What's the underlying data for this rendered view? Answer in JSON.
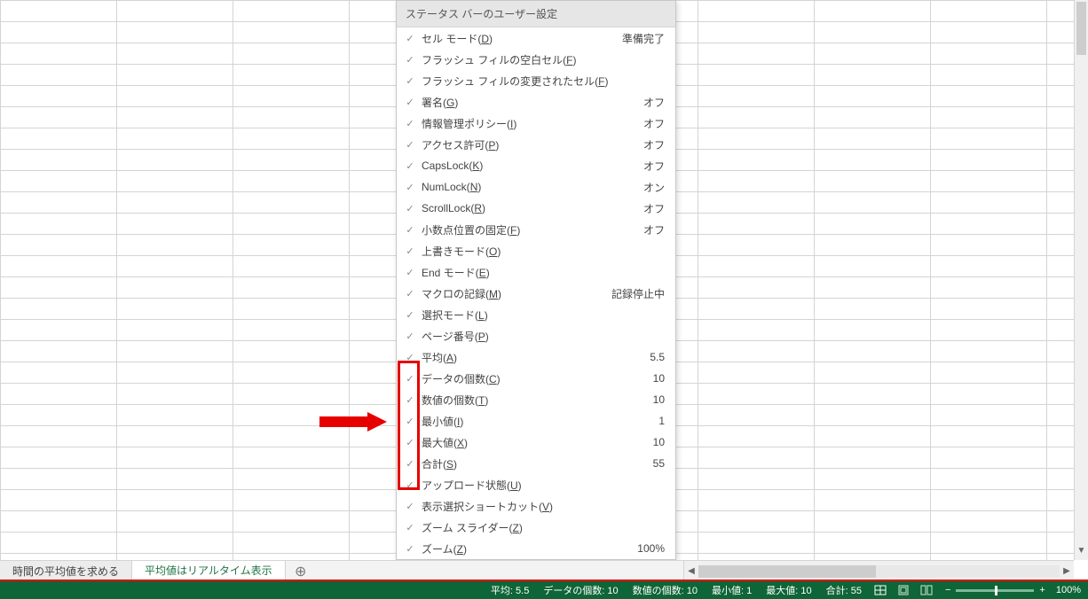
{
  "menu": {
    "title": "ステータス バーのユーザー設定",
    "items": [
      {
        "label": "セル モード(D)",
        "ul": "D",
        "status": "準備完了"
      },
      {
        "label": "フラッシュ フィルの空白セル(F)",
        "ul": "F",
        "status": ""
      },
      {
        "label": "フラッシュ フィルの変更されたセル(F)",
        "ul": "F",
        "status": ""
      },
      {
        "label": "署名(G)",
        "ul": "G",
        "status": "オフ"
      },
      {
        "label": "情報管理ポリシー(I)",
        "ul": "I",
        "status": "オフ"
      },
      {
        "label": "アクセス許可(P)",
        "ul": "P",
        "status": "オフ"
      },
      {
        "label": "CapsLock(K)",
        "ul": "K",
        "status": "オフ"
      },
      {
        "label": "NumLock(N)",
        "ul": "N",
        "status": "オン"
      },
      {
        "label": "ScrollLock(R)",
        "ul": "R",
        "status": "オフ"
      },
      {
        "label": "小数点位置の固定(F)",
        "ul": "F",
        "status": "オフ"
      },
      {
        "label": "上書きモード(O)",
        "ul": "O",
        "status": ""
      },
      {
        "label": "End モード(E)",
        "ul": "E",
        "status": ""
      },
      {
        "label": "マクロの記録(M)",
        "ul": "M",
        "status": "記録停止中"
      },
      {
        "label": "選択モード(L)",
        "ul": "L",
        "status": ""
      },
      {
        "label": "ページ番号(P)",
        "ul": "P",
        "status": ""
      },
      {
        "label": "平均(A)",
        "ul": "A",
        "status": "5.5"
      },
      {
        "label": "データの個数(C)",
        "ul": "C",
        "status": "10"
      },
      {
        "label": "数値の個数(T)",
        "ul": "T",
        "status": "10"
      },
      {
        "label": "最小値(I)",
        "ul": "I",
        "status": "1"
      },
      {
        "label": "最大値(X)",
        "ul": "X",
        "status": "10"
      },
      {
        "label": "合計(S)",
        "ul": "S",
        "status": "55"
      },
      {
        "label": "アップロード状態(U)",
        "ul": "U",
        "status": ""
      },
      {
        "label": "表示選択ショートカット(V)",
        "ul": "V",
        "status": ""
      },
      {
        "label": "ズーム スライダー(Z)",
        "ul": "Z",
        "status": ""
      },
      {
        "label": "ズーム(Z)",
        "ul": "Z",
        "status": "100%"
      }
    ]
  },
  "tabs": {
    "items": [
      {
        "label": "時間の平均値を求める",
        "active": false
      },
      {
        "label": "平均値はリアルタイム表示",
        "active": true
      }
    ],
    "add_icon": "⊕"
  },
  "statusbar": {
    "stats": [
      {
        "label": "平均:",
        "value": "5.5"
      },
      {
        "label": "データの個数:",
        "value": "10"
      },
      {
        "label": "数値の個数:",
        "value": "10"
      },
      {
        "label": "最小値:",
        "value": "1"
      },
      {
        "label": "最大値:",
        "value": "10"
      },
      {
        "label": "合計:",
        "value": "55"
      }
    ],
    "zoom": "100%"
  }
}
